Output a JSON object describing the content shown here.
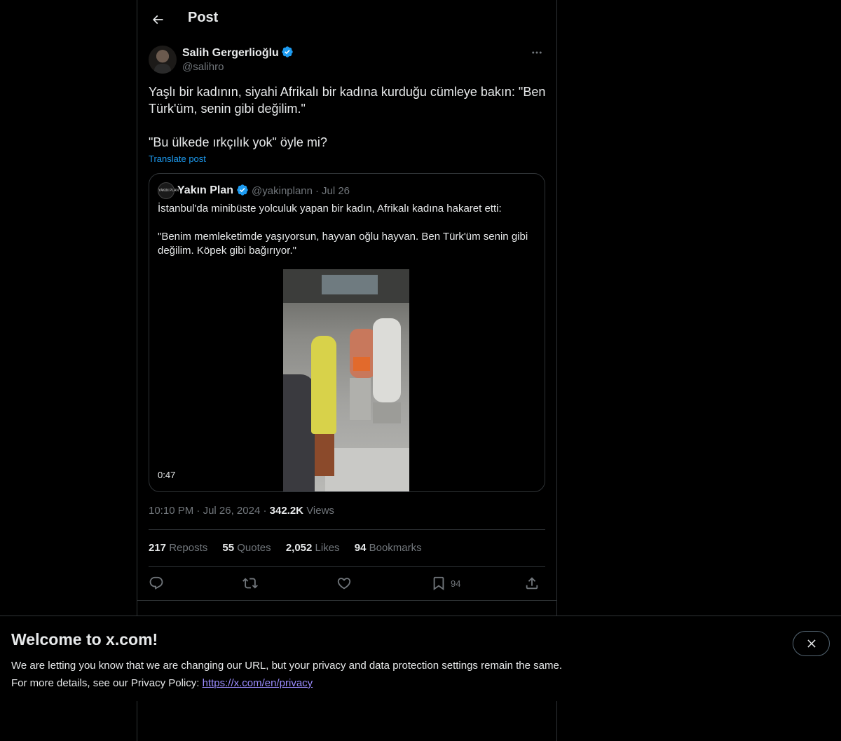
{
  "header": {
    "title": "Post"
  },
  "post": {
    "author_name": "Salih Gergerlioğlu",
    "author_handle": "@salihro",
    "text_line1": "Yaşlı bir kadının, siyahi Afrikalı bir kadına kurduğu cümleye bakın: \"Ben Türk'üm, senin gibi değilim.\"",
    "text_line2": "\"Bu ülkede ırkçılık yok\" öyle mi?",
    "translate_label": "Translate post",
    "time": "10:10 PM",
    "date": "Jul 26, 2024",
    "views_count": "342.2K",
    "views_label": "Views"
  },
  "quote": {
    "avatar_text": "YAKIN PLAN",
    "name": "Yakın Plan",
    "handle": "@yakinplann",
    "date": "Jul 26",
    "text_line1": "İstanbul'da minibüste yolculuk yapan bir kadın, Afrikalı kadına hakaret etti:",
    "text_line2": "\"Benim memleketimde yaşıyorsun, hayvan oğlu hayvan. Ben Türk'üm senin gibi değilim. Köpek gibi bağırıyor.\"",
    "video_duration": "0:47"
  },
  "stats": {
    "reposts_count": "217",
    "reposts_label": "Reposts",
    "quotes_count": "55",
    "quotes_label": "Quotes",
    "likes_count": "2,052",
    "likes_label": "Likes",
    "bookmarks_count": "94",
    "bookmarks_label": "Bookmarks"
  },
  "actions": {
    "bookmark_count": "94"
  },
  "banner": {
    "title": "Welcome to x.com!",
    "line1": "We are letting you know that we are changing our URL, but your privacy and data protection settings remain the same.",
    "line2_prefix": "For more details, see our Privacy Policy:",
    "link": "https://x.com/en/privacy"
  },
  "colors": {
    "accent": "#1d9bf0",
    "background": "#000000",
    "muted": "#71767b",
    "border": "#2f3336",
    "link": "#9b8cff"
  },
  "icons": [
    "back-arrow-icon",
    "verified-badge-icon",
    "more-icon",
    "reply-icon",
    "repost-icon",
    "like-icon",
    "bookmark-icon",
    "share-icon",
    "close-icon"
  ]
}
